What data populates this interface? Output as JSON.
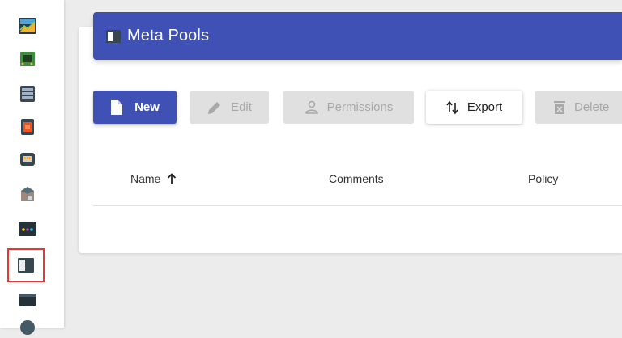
{
  "sidebar": {
    "items": [
      {
        "name": "dashboard"
      },
      {
        "name": "hardware"
      },
      {
        "name": "storage"
      },
      {
        "name": "firewall"
      },
      {
        "name": "network"
      },
      {
        "name": "services"
      },
      {
        "name": "console"
      },
      {
        "name": "meta-pools",
        "selected": true
      },
      {
        "name": "folders"
      },
      {
        "name": "more"
      }
    ]
  },
  "header": {
    "title": "Meta Pools"
  },
  "toolbar": {
    "new_label": "New",
    "edit_label": "Edit",
    "permissions_label": "Permissions",
    "export_label": "Export",
    "delete_label": "Delete"
  },
  "table": {
    "columns": [
      "Name",
      "Comments",
      "Policy"
    ],
    "sort_column": "Name",
    "sort_direction": "ascending"
  },
  "colors": {
    "primary": "#3f51b5",
    "selection_outline": "#e53935",
    "disabled": "#e0e0e0",
    "background": "#ececec"
  }
}
